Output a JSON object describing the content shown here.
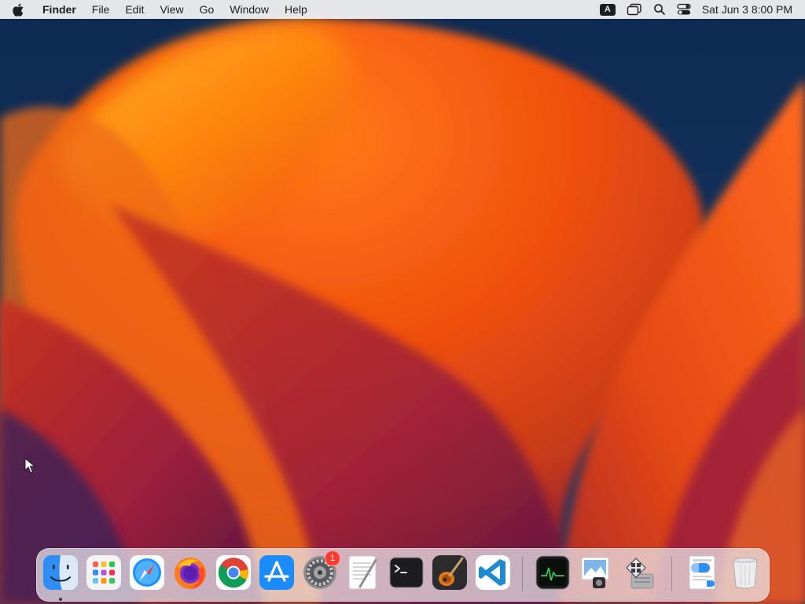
{
  "menubar": {
    "apple_icon": "apple-logo-icon",
    "app_name": "Finder",
    "menus": [
      "File",
      "Edit",
      "View",
      "Go",
      "Window",
      "Help"
    ],
    "status": {
      "input_source": "A",
      "icons": [
        "screen-mirroring-icon",
        "spotlight-search-icon",
        "control-center-icon"
      ],
      "clock": "Sat Jun 3  8:00 PM"
    }
  },
  "dock": {
    "apps": [
      {
        "name": "Finder",
        "icon": "finder-icon",
        "running": true
      },
      {
        "name": "Launchpad",
        "icon": "launchpad-icon"
      },
      {
        "name": "Safari",
        "icon": "safari-icon"
      },
      {
        "name": "Firefox",
        "icon": "firefox-icon"
      },
      {
        "name": "Google Chrome",
        "icon": "chrome-icon"
      },
      {
        "name": "App Store",
        "icon": "app-store-icon"
      },
      {
        "name": "System Settings",
        "icon": "system-settings-icon",
        "badge": "1"
      },
      {
        "name": "TextEdit",
        "icon": "textedit-icon"
      },
      {
        "name": "Terminal",
        "icon": "terminal-icon"
      },
      {
        "name": "GarageBand",
        "icon": "garageband-icon"
      },
      {
        "name": "Visual Studio Code",
        "icon": "vscode-icon"
      }
    ],
    "recent": [
      {
        "name": "Activity Monitor",
        "icon": "activity-monitor-icon"
      },
      {
        "name": "Preview",
        "icon": "preview-icon"
      },
      {
        "name": "Boot Camp Assistant",
        "icon": "boot-camp-icon"
      }
    ],
    "persistent": [
      {
        "name": "Downloads",
        "icon": "downloads-stack-icon"
      },
      {
        "name": "Trash",
        "icon": "trash-icon"
      }
    ]
  },
  "colors": {
    "wallpaper_background": "#0f2f57",
    "wallpaper_orange": "#f05a14",
    "wallpaper_magenta": "#8a1c3a",
    "badge": "#ff3b30"
  }
}
